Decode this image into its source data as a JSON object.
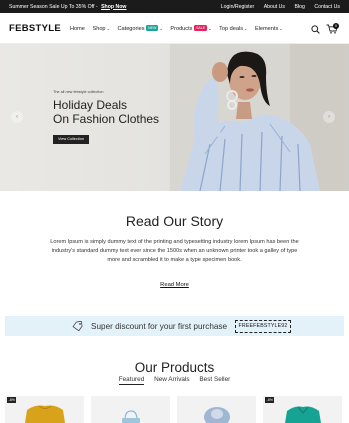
{
  "topbar": {
    "promo_text": "Summer Season Sale Up To 35% Off -",
    "promo_link": "Shop Now",
    "links": [
      "Login/Register",
      "About Us",
      "Blog",
      "Contact Us"
    ]
  },
  "header": {
    "logo": "FEBSTYLE",
    "nav": [
      {
        "label": "Home"
      },
      {
        "label": "Shop"
      },
      {
        "label": "Categories",
        "badge": "NEW",
        "badge_color": "#1aa39a"
      },
      {
        "label": "Products",
        "badge": "SALE",
        "badge_color": "#e8215c"
      },
      {
        "label": "Top deals"
      },
      {
        "label": "Elements"
      }
    ],
    "cart_count": "0"
  },
  "hero": {
    "small_text": "The all new febstyle collection",
    "title_line1": "Holiday Deals",
    "title_line2": "On Fashion Clothes",
    "button": "View Collection",
    "arrow_left": "‹",
    "arrow_right": "›"
  },
  "story": {
    "title": "Read Our Story",
    "text": "Lorem Ipsum is simply dummy text of the printing and typesetting industry lorem Ipsum has been the industry's standard dummy text ever since the 1500s when an unknown printer took a galley of type more and scrambled it to make a type specimen book.",
    "link": "Read More"
  },
  "discount": {
    "text": "Super discount for your first purchase",
    "code": "FREEFEBSTYLE92"
  },
  "products": {
    "title": "Our Products",
    "tabs": [
      "Featured",
      "New Arrivals",
      "Best Seller"
    ],
    "cards": [
      {
        "sale": "-8%"
      },
      {
        "sale": ""
      },
      {
        "sale": ""
      },
      {
        "sale": "-8%"
      }
    ]
  },
  "colors": {
    "topbar": "#1b1b1b",
    "discount_bg": "#e3f1f8",
    "new_badge": "#1aa39a",
    "sale_badge": "#e8215c"
  }
}
